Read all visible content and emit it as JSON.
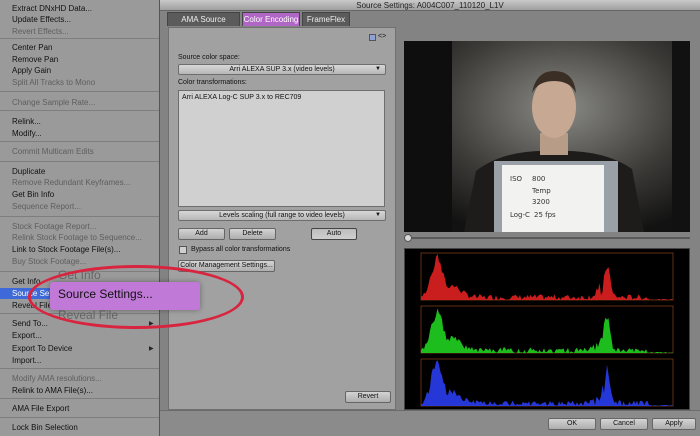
{
  "context_menu": {
    "items": [
      {
        "label": "Extract DNxHD Data...",
        "disabled": false
      },
      {
        "label": "Update Effects...",
        "disabled": false
      },
      {
        "label": "Revert Effects...",
        "disabled": true
      },
      {
        "label": "Center Pan",
        "disabled": false
      },
      {
        "label": "Remove Pan",
        "disabled": false
      },
      {
        "label": "Apply Gain",
        "disabled": false
      },
      {
        "label": "Split All Tracks to Mono",
        "disabled": true
      },
      {
        "label": "Change Sample Rate...",
        "disabled": true
      },
      {
        "label": "Relink...",
        "disabled": false
      },
      {
        "label": "Modify...",
        "disabled": false
      },
      {
        "label": "Commit Multicam Edits",
        "disabled": true
      },
      {
        "label": "Duplicate",
        "disabled": false
      },
      {
        "label": "Remove Redundant Keyframes...",
        "disabled": true
      },
      {
        "label": "Get Bin Info",
        "disabled": false
      },
      {
        "label": "Sequence Report...",
        "disabled": true
      },
      {
        "label": "Stock Footage Report...",
        "disabled": true
      },
      {
        "label": "Relink Stock Footage to Sequence...",
        "disabled": true
      },
      {
        "label": "Link to Stock Footage File(s)...",
        "disabled": false
      },
      {
        "label": "Buy Stock Footage...",
        "disabled": true
      },
      {
        "label": "Get Info",
        "disabled": false
      },
      {
        "label": "Source Settings...",
        "disabled": false,
        "highlighted": true
      },
      {
        "label": "Reveal File",
        "disabled": false
      },
      {
        "label": "Send To...",
        "disabled": false
      },
      {
        "label": "Export...",
        "disabled": false
      },
      {
        "label": "Export To Device",
        "disabled": false
      },
      {
        "label": "Import...",
        "disabled": false
      },
      {
        "label": "Modify AMA resolutions...",
        "disabled": true
      },
      {
        "label": "Relink to AMA File(s)...",
        "disabled": false
      },
      {
        "label": "AMA File Export",
        "disabled": false
      },
      {
        "label": "Lock Bin Selection",
        "disabled": false
      }
    ],
    "highlighted_short": "Source Setti"
  },
  "callout": {
    "label": "Source Settings...",
    "ghost_above": "Get Info",
    "ghost_below": "Reveal File"
  },
  "dialog": {
    "title": "Source Settings: A004C007_110120_L1V",
    "tabs": [
      "AMA Source Settings",
      "Color Encoding",
      "FrameFlex"
    ],
    "active_tab": "Color Encoding",
    "link_icon_text": "<>",
    "source_color_space_label": "Source color space:",
    "source_color_space_value": "Arri ALEXA SUP 3.x (video levels)",
    "color_transformations_label": "Color transformations:",
    "transformations": [
      "Arri ALEXA Log-C SUP 3.x to REC709"
    ],
    "levels_scaling": "Levels scaling (full range to video levels)",
    "buttons": {
      "add": "Add",
      "delete": "Delete",
      "auto": "Auto"
    },
    "bypass_label": "Bypass all color transformations",
    "color_management_button": "Color Management Settings...",
    "revert_button": "Revert",
    "footer": {
      "ok": "OK",
      "cancel": "Cancel",
      "apply": "Apply"
    }
  },
  "preview": {
    "card_lines": [
      "ISO",
      "Temp",
      "Log-C",
      "25 fps"
    ],
    "card_values": [
      "800",
      "3200",
      "",
      ""
    ]
  },
  "colors": {
    "menu_bg": "#9a9a9a",
    "highlight": "#3d6ad8",
    "active_tab": "#b066c5",
    "callout_ring": "#d9243f",
    "callout_fill": "#c079d6"
  }
}
